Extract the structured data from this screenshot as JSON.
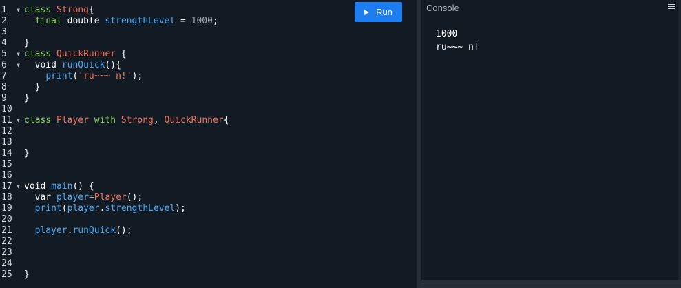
{
  "toolbar": {
    "run_label": "Run"
  },
  "console": {
    "title": "Console",
    "output": [
      "1000",
      "ru~~~ n!"
    ]
  },
  "editor": {
    "lines": [
      {
        "num": "1",
        "fold": "▼",
        "tokens": [
          {
            "t": "class ",
            "c": "kw"
          },
          {
            "t": "Strong",
            "c": "cls"
          },
          {
            "t": "{",
            "c": "plain"
          }
        ]
      },
      {
        "num": "2",
        "fold": "",
        "tokens": [
          {
            "t": "  final ",
            "c": "kw"
          },
          {
            "t": "double ",
            "c": "plain"
          },
          {
            "t": "strengthLevel",
            "c": "fn"
          },
          {
            "t": " = ",
            "c": "plain"
          },
          {
            "t": "1000",
            "c": "num"
          },
          {
            "t": ";",
            "c": "plain"
          }
        ]
      },
      {
        "num": "3",
        "fold": "",
        "tokens": []
      },
      {
        "num": "4",
        "fold": "",
        "tokens": [
          {
            "t": "}",
            "c": "plain"
          }
        ]
      },
      {
        "num": "5",
        "fold": "▼",
        "tokens": [
          {
            "t": "class ",
            "c": "kw"
          },
          {
            "t": "QuickRunner",
            "c": "cls"
          },
          {
            "t": " {",
            "c": "plain"
          }
        ]
      },
      {
        "num": "6",
        "fold": "▼",
        "tokens": [
          {
            "t": "  void ",
            "c": "plain"
          },
          {
            "t": "runQuick",
            "c": "fn"
          },
          {
            "t": "(){",
            "c": "plain"
          }
        ]
      },
      {
        "num": "7",
        "fold": "",
        "tokens": [
          {
            "t": "    ",
            "c": "plain"
          },
          {
            "t": "print",
            "c": "fn"
          },
          {
            "t": "(",
            "c": "plain"
          },
          {
            "t": "'ru~~~ n!'",
            "c": "str"
          },
          {
            "t": ");",
            "c": "plain"
          }
        ]
      },
      {
        "num": "8",
        "fold": "",
        "tokens": [
          {
            "t": "  }",
            "c": "plain"
          }
        ]
      },
      {
        "num": "9",
        "fold": "",
        "tokens": [
          {
            "t": "}",
            "c": "plain"
          }
        ]
      },
      {
        "num": "10",
        "fold": "",
        "tokens": []
      },
      {
        "num": "11",
        "fold": "▼",
        "tokens": [
          {
            "t": "class ",
            "c": "kw"
          },
          {
            "t": "Player ",
            "c": "cls"
          },
          {
            "t": "with ",
            "c": "kw"
          },
          {
            "t": "Strong",
            "c": "cls"
          },
          {
            "t": ", ",
            "c": "plain"
          },
          {
            "t": "QuickRunner",
            "c": "cls"
          },
          {
            "t": "{",
            "c": "plain"
          }
        ]
      },
      {
        "num": "12",
        "fold": "",
        "tokens": []
      },
      {
        "num": "13",
        "fold": "",
        "tokens": []
      },
      {
        "num": "14",
        "fold": "",
        "tokens": [
          {
            "t": "}",
            "c": "plain"
          }
        ]
      },
      {
        "num": "15",
        "fold": "",
        "tokens": []
      },
      {
        "num": "16",
        "fold": "",
        "tokens": []
      },
      {
        "num": "17",
        "fold": "▼",
        "tokens": [
          {
            "t": "void ",
            "c": "plain"
          },
          {
            "t": "main",
            "c": "fn"
          },
          {
            "t": "() {",
            "c": "plain"
          }
        ]
      },
      {
        "num": "18",
        "fold": "",
        "tokens": [
          {
            "t": "  var ",
            "c": "plain"
          },
          {
            "t": "player",
            "c": "fn"
          },
          {
            "t": "=",
            "c": "plain"
          },
          {
            "t": "Player",
            "c": "cls"
          },
          {
            "t": "();",
            "c": "plain"
          }
        ]
      },
      {
        "num": "19",
        "fold": "",
        "tokens": [
          {
            "t": "  ",
            "c": "plain"
          },
          {
            "t": "print",
            "c": "fn"
          },
          {
            "t": "(",
            "c": "plain"
          },
          {
            "t": "player",
            "c": "fn"
          },
          {
            "t": ".",
            "c": "plain"
          },
          {
            "t": "strengthLevel",
            "c": "fn"
          },
          {
            "t": ");",
            "c": "plain"
          }
        ]
      },
      {
        "num": "20",
        "fold": "",
        "tokens": []
      },
      {
        "num": "21",
        "fold": "",
        "tokens": [
          {
            "t": "  ",
            "c": "plain"
          },
          {
            "t": "player",
            "c": "fn"
          },
          {
            "t": ".",
            "c": "plain"
          },
          {
            "t": "runQuick",
            "c": "fn"
          },
          {
            "t": "();",
            "c": "plain"
          }
        ]
      },
      {
        "num": "22",
        "fold": "",
        "tokens": []
      },
      {
        "num": "23",
        "fold": "",
        "tokens": []
      },
      {
        "num": "24",
        "fold": "",
        "tokens": []
      },
      {
        "num": "25",
        "fold": "",
        "tokens": [
          {
            "t": "}",
            "c": "plain"
          }
        ]
      }
    ]
  }
}
